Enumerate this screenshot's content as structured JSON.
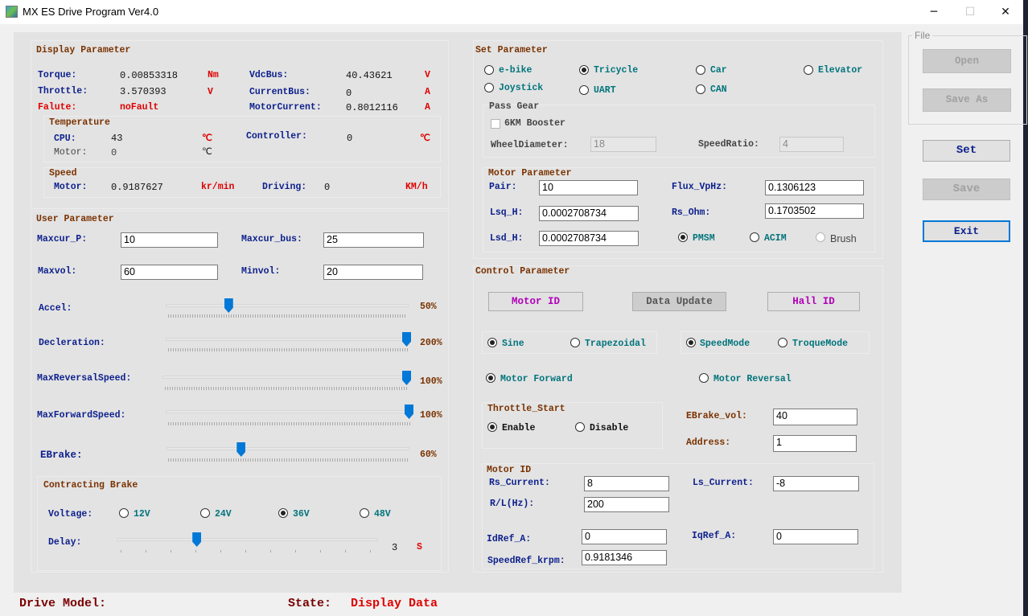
{
  "window": {
    "title": "MX ES Drive Program Ver4.0",
    "minimize": "─",
    "maximize": "☐",
    "close": "✕"
  },
  "display": {
    "title": "Display Parameter",
    "torque_label": "Torque:",
    "torque_value": "0.00853318",
    "torque_unit": "Nm",
    "vdcbus_label": "VdcBus:",
    "vdcbus_value": "40.43621",
    "vdcbus_unit": "V",
    "throttle_label": "Throttle:",
    "throttle_value": "3.570393",
    "throttle_unit": "V",
    "currentbus_label": "CurrentBus:",
    "currentbus_value": "0",
    "currentbus_unit": "A",
    "falute_label": "Falute:",
    "falute_value": "noFault",
    "motorcurrent_label": "MotorCurrent:",
    "motorcurrent_value": "0.8012116",
    "motorcurrent_unit": "A",
    "temperature": {
      "title": "Temperature",
      "cpu_label": "CPU:",
      "cpu_value": "43",
      "cpu_unit": "℃",
      "controller_label": "Controller:",
      "controller_value": "0",
      "controller_unit": "℃",
      "motor_label": "Motor:",
      "motor_value": "0",
      "motor_unit": "℃"
    },
    "speed": {
      "title": "Speed",
      "motor_label": "Motor:",
      "motor_value": "0.9187627",
      "motor_unit": "kr/min",
      "driving_label": "Driving:",
      "driving_value": "0",
      "driving_unit": "KM/h"
    }
  },
  "user": {
    "title": "User Parameter",
    "maxcur_p_label": "Maxcur_P:",
    "maxcur_p_value": "10",
    "maxcur_bus_label": "Maxcur_bus:",
    "maxcur_bus_value": "25",
    "maxvol_label": "Maxvol:",
    "maxvol_value": "60",
    "minvol_label": "Minvol:",
    "minvol_value": "20",
    "sliders": [
      {
        "label": "Accel:",
        "display": "50%",
        "fraction": 0.25
      },
      {
        "label": "Decleration:",
        "display": "200%",
        "fraction": 1.0
      },
      {
        "label": "MaxReversalSpeed:",
        "display": "100%",
        "fraction": 1.0
      },
      {
        "label": "MaxForwardSpeed:",
        "display": "100%",
        "fraction": 1.0
      },
      {
        "label": "EBrake:",
        "display": "60%",
        "fraction": 0.3
      }
    ],
    "brake": {
      "title": "Contracting Brake",
      "voltage_label": "Voltage:",
      "voltages": [
        {
          "label": "12V",
          "selected": false
        },
        {
          "label": "24V",
          "selected": false
        },
        {
          "label": "36V",
          "selected": true
        },
        {
          "label": "48V",
          "selected": false
        }
      ],
      "delay_label": "Delay:",
      "delay_value": "3",
      "delay_unit": "S",
      "delay_fraction": 0.3
    }
  },
  "set": {
    "title": "Set Parameter",
    "vehicles": [
      {
        "label": "e-bike",
        "selected": false
      },
      {
        "label": "Tricycle",
        "selected": true
      },
      {
        "label": "Car",
        "selected": false
      },
      {
        "label": "Elevator",
        "selected": false
      },
      {
        "label": "Joystick",
        "selected": false
      },
      {
        "label": "UART",
        "selected": false
      },
      {
        "label": "CAN",
        "selected": false
      }
    ],
    "pass_gear": {
      "title": "Pass Gear",
      "booster_label": "6KM Booster",
      "booster_checked": false,
      "wheel_label": "WheelDiameter:",
      "wheel_value": "18",
      "ratio_label": "SpeedRatio:",
      "ratio_value": "4"
    },
    "motor": {
      "title": "Motor Parameter",
      "pair_label": "Pair:",
      "pair_value": "10",
      "flux_label": "Flux_VpHz:",
      "flux_value": "0.1306123",
      "lsq_label": "Lsq_H:",
      "lsq_value": "0.0002708734",
      "rs_label": "Rs_Ohm:",
      "rs_value": "0.1703502",
      "lsd_label": "Lsd_H:",
      "lsd_value": "0.0002708734",
      "types": [
        {
          "label": "PMSM",
          "selected": true
        },
        {
          "label": "ACIM",
          "selected": false
        },
        {
          "label": "Brush",
          "selected": false
        }
      ]
    }
  },
  "control": {
    "title": "Control Parameter",
    "motor_id_button": "Motor ID",
    "data_update_button": "Data Update",
    "hall_id_button": "Hall ID",
    "wave": [
      {
        "label": "Sine",
        "selected": true
      },
      {
        "label": "Trapezoidal",
        "selected": false
      }
    ],
    "mode": [
      {
        "label": "SpeedMode",
        "selected": true
      },
      {
        "label": "TroqueMode",
        "selected": false
      }
    ],
    "direction": [
      {
        "label": "Motor Forward",
        "selected": true
      },
      {
        "label": "Motor Reversal",
        "selected": false
      }
    ],
    "throttle_start": {
      "title": "Throttle_Start",
      "options": [
        {
          "label": "Enable",
          "selected": true
        },
        {
          "label": "Disable",
          "selected": false
        }
      ]
    },
    "ebrake_vol_label": "EBrake_vol:",
    "ebrake_vol_value": "40",
    "address_label": "Address:",
    "address_value": "1",
    "motor_id": {
      "title": "Motor ID",
      "rs_current_label": "Rs_Current:",
      "rs_current_value": "8",
      "ls_current_label": "Ls_Current:",
      "ls_current_value": "-8",
      "rl_label": "R/L(Hz):",
      "rl_value": "200",
      "idref_label": "IdRef_A:",
      "idref_value": "0",
      "iqref_label": "IqRef_A:",
      "iqref_value": "0",
      "speedref_label": "SpeedRef_krpm:",
      "speedref_value": "0.9181346"
    }
  },
  "file": {
    "title": "File",
    "open": "Open",
    "save_as": "Save As"
  },
  "actions": {
    "set": "Set",
    "save": "Save",
    "exit": "Exit"
  },
  "status": {
    "drive_model_label": "Drive Model:",
    "drive_model_value": "",
    "state_label": "State:",
    "state_value": "Display Data"
  },
  "colors": {
    "label": "#0c1f8c",
    "unit": "#e00000",
    "heading": "#7a3200",
    "option": "#00747c",
    "accent": "#0078d7",
    "motor_id": "#b000b8"
  }
}
